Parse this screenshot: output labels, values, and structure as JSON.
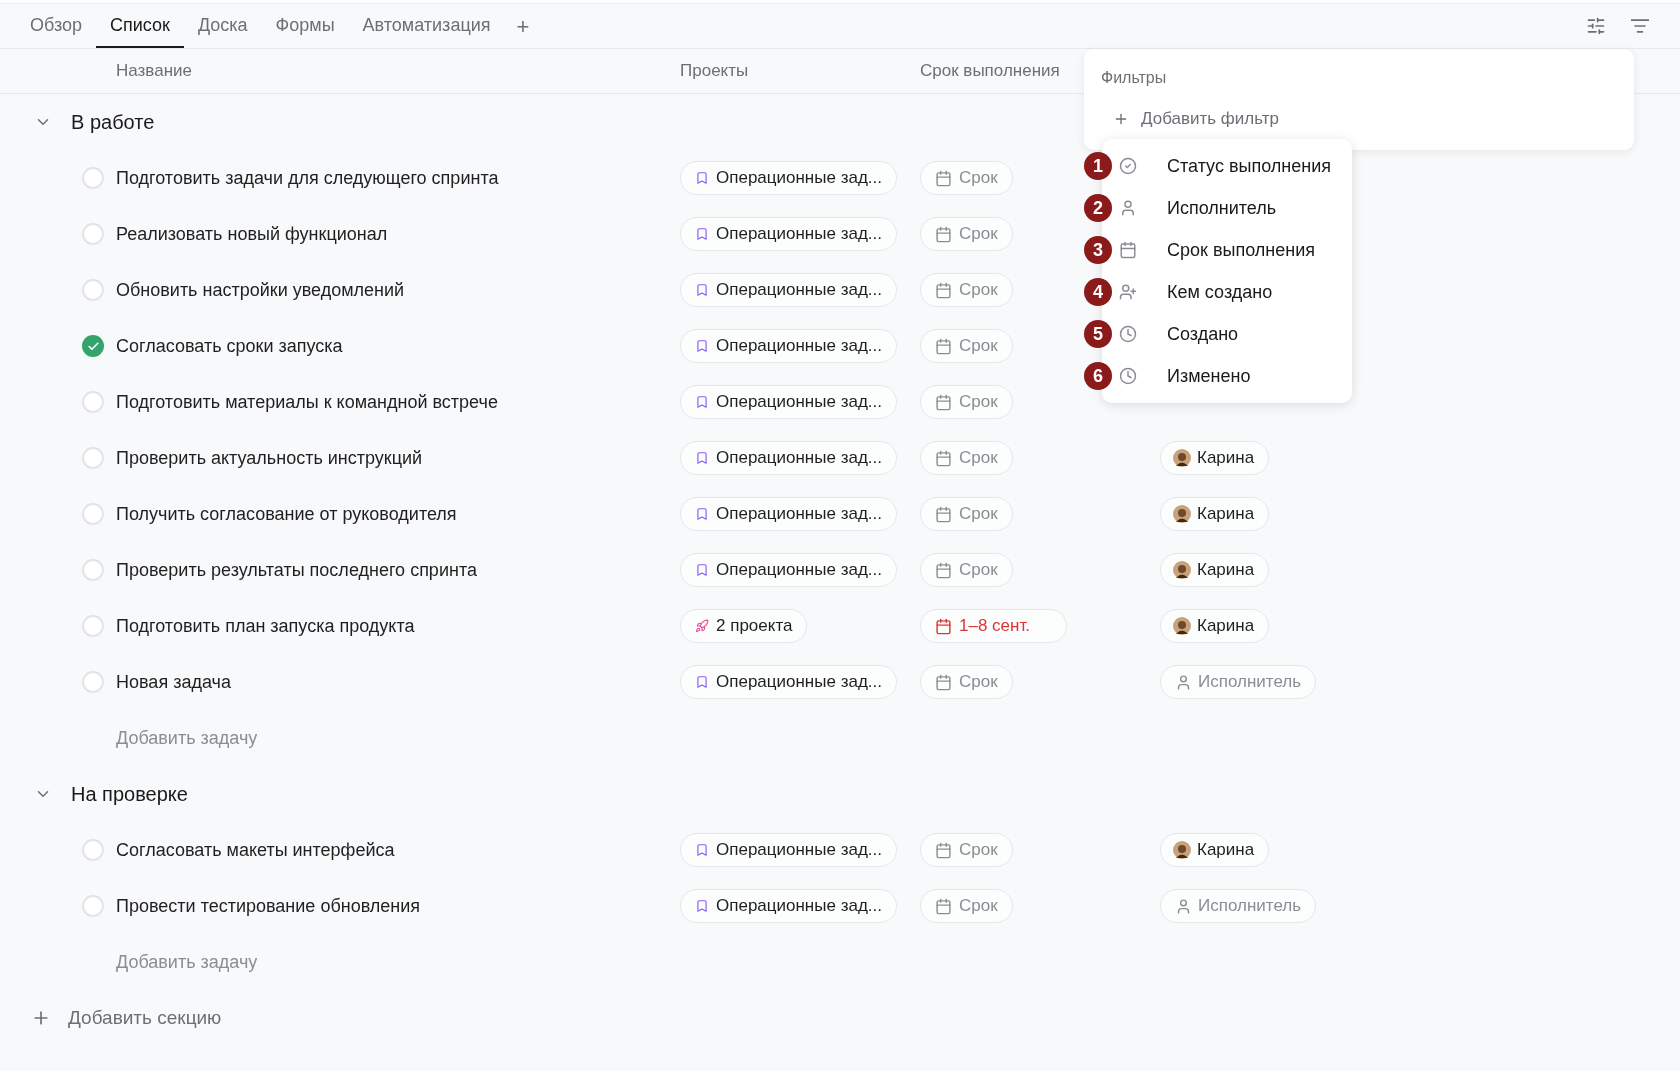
{
  "tabs": [
    {
      "label": "Обзор",
      "selected": false
    },
    {
      "label": "Список",
      "selected": true
    },
    {
      "label": "Доска",
      "selected": false
    },
    {
      "label": "Формы",
      "selected": false
    },
    {
      "label": "Автоматизация",
      "selected": false
    }
  ],
  "add_tab": "+",
  "columns": [
    "Название",
    "Проекты",
    "Срок выполнения"
  ],
  "sections": [
    {
      "title": "В работе",
      "expanded": true,
      "add_task": "Добавить задачу",
      "tasks": [
        {
          "name": "Подготовить задачи для следующего спринта",
          "done": false,
          "project": {
            "kind": "single",
            "label": "Операционные зад..."
          },
          "due": {
            "label": "Срок",
            "overdue": false
          }
        },
        {
          "name": "Реализовать новый функционал",
          "done": false,
          "project": {
            "kind": "single",
            "label": "Операционные зад..."
          },
          "due": {
            "label": "Срок",
            "overdue": false
          }
        },
        {
          "name": "Обновить настройки уведомлений",
          "done": false,
          "project": {
            "kind": "single",
            "label": "Операционные зад..."
          },
          "due": {
            "label": "Срок",
            "overdue": false
          }
        },
        {
          "name": "Согласовать сроки запуска",
          "done": true,
          "project": {
            "kind": "single",
            "label": "Операционные зад..."
          },
          "due": {
            "label": "Срок",
            "overdue": false
          }
        },
        {
          "name": "Подготовить материалы к командной встрече",
          "done": false,
          "project": {
            "kind": "single",
            "label": "Операционные зад..."
          },
          "due": {
            "label": "Срок",
            "overdue": false
          }
        },
        {
          "name": "Проверить актуальность инструкций",
          "done": false,
          "project": {
            "kind": "single",
            "label": "Операционные зад..."
          },
          "due": {
            "label": "Срок",
            "overdue": false
          },
          "assignee": {
            "kind": "person",
            "label": "Карина"
          }
        },
        {
          "name": "Получить согласование от руководителя",
          "done": false,
          "project": {
            "kind": "single",
            "label": "Операционные зад..."
          },
          "due": {
            "label": "Срок",
            "overdue": false
          },
          "assignee": {
            "kind": "person",
            "label": "Карина"
          }
        },
        {
          "name": "Проверить результаты последнего спринта",
          "done": false,
          "project": {
            "kind": "single",
            "label": "Операционные зад..."
          },
          "due": {
            "label": "Срок",
            "overdue": false
          },
          "assignee": {
            "kind": "person",
            "label": "Карина"
          }
        },
        {
          "name": "Подготовить план запуска продукта",
          "done": false,
          "project": {
            "kind": "multi",
            "label": "2 проекта"
          },
          "due": {
            "label": "1–8 сент.",
            "overdue": true
          },
          "assignee": {
            "kind": "person",
            "label": "Карина"
          }
        },
        {
          "name": "Новая задача",
          "done": false,
          "project": {
            "kind": "single",
            "label": "Операционные зад..."
          },
          "due": {
            "label": "Срок",
            "overdue": false
          },
          "assignee": {
            "kind": "empty",
            "label": "Исполнитель"
          }
        }
      ]
    },
    {
      "title": "На проверке",
      "expanded": true,
      "add_task": "Добавить задачу",
      "tasks": [
        {
          "name": "Согласовать макеты интерфейса",
          "done": false,
          "project": {
            "kind": "single",
            "label": "Операционные зад..."
          },
          "due": {
            "label": "Срок",
            "overdue": false
          },
          "assignee": {
            "kind": "person",
            "label": "Карина"
          }
        },
        {
          "name": "Провести тестирование обновления",
          "done": false,
          "project": {
            "kind": "single",
            "label": "Операционные зад..."
          },
          "due": {
            "label": "Срок",
            "overdue": false
          },
          "assignee": {
            "kind": "empty",
            "label": "Исполнитель"
          }
        }
      ]
    }
  ],
  "add_section": "Добавить секцию",
  "filter_panel": {
    "title": "Фильтры",
    "add_filter": "Добавить фильтр"
  },
  "filter_menu": [
    {
      "badge": "1",
      "kind": "status",
      "label": "Статус выполнения"
    },
    {
      "badge": "2",
      "kind": "person",
      "label": "Исполнитель"
    },
    {
      "badge": "3",
      "kind": "date",
      "label": "Срок выполнения"
    },
    {
      "badge": "4",
      "kind": "creator",
      "label": "Кем создано"
    },
    {
      "badge": "5",
      "kind": "time",
      "label": "Создано"
    },
    {
      "badge": "6",
      "kind": "time",
      "label": "Изменено"
    }
  ]
}
